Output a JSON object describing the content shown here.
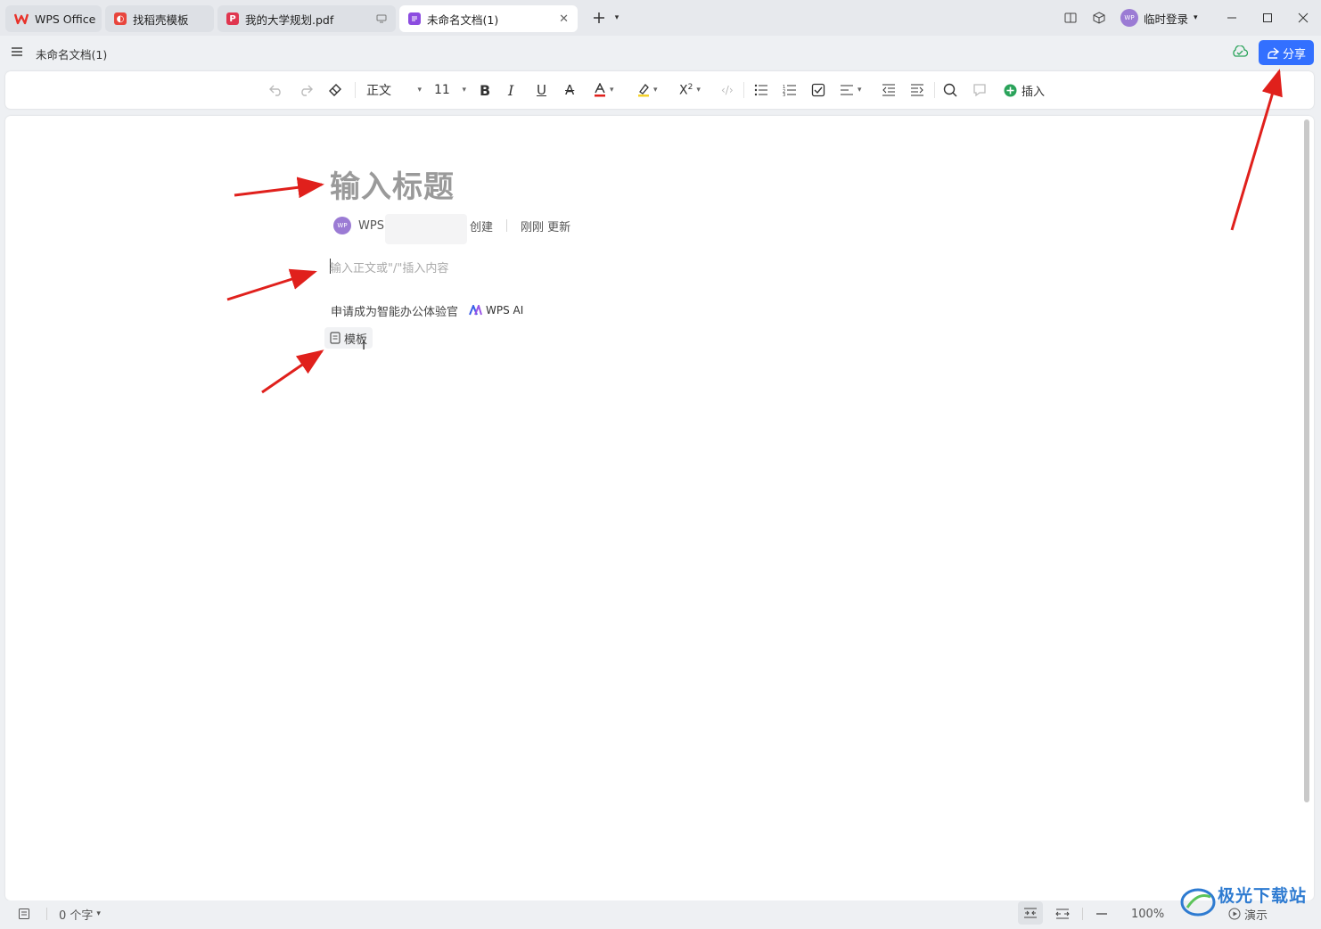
{
  "tabs": [
    {
      "label": "WPS Office",
      "icon": "wps-logo-icon",
      "color": "#e8322a"
    },
    {
      "label": "找稻壳模板",
      "icon": "docer-icon",
      "color": "#e8453c"
    },
    {
      "label": "我的大学规划.pdf",
      "icon": "pdf-icon",
      "color": "#e0364f"
    },
    {
      "label": "未命名文档(1)",
      "icon": "doc-icon",
      "color": "#8c4ce0"
    }
  ],
  "window": {
    "login_label": "临时登录",
    "avatar_text": "WP"
  },
  "titlebar": {
    "doc_name": "未命名文档(1)",
    "share_label": "分享"
  },
  "toolbar": {
    "style_value": "正文",
    "font_size_value": "11",
    "insert_label": "插入"
  },
  "document": {
    "title_placeholder": "输入标题",
    "author_avatar": "WP",
    "author_name": "WPS",
    "created_label": "创建",
    "updated_label": "刚刚 更新",
    "body_placeholder": "输入正文或\"/\"插入内容",
    "ai_promo": "申请成为智能办公体验官",
    "ai_brand": "WPS AI",
    "template_label": "模板"
  },
  "statusbar": {
    "word_count": "0 个字",
    "zoom": "100%",
    "present_label": "演示"
  },
  "watermark": {
    "text": "极光下载站"
  },
  "colors": {
    "accent": "#3370ff",
    "annotation_arrow": "#e0201c"
  }
}
